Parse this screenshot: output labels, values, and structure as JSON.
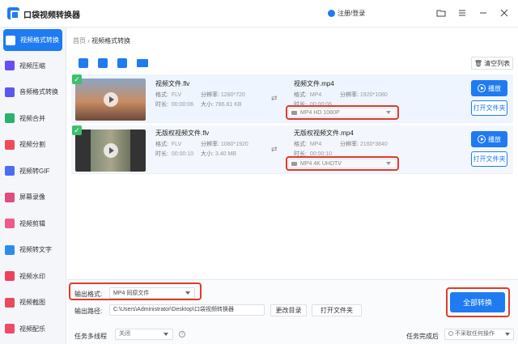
{
  "app": {
    "title": "口袋视频转换器",
    "login": "注册/登录"
  },
  "sidebar": {
    "items": [
      {
        "label": "视频格式转换",
        "icon": "film-convert-icon",
        "color": "#1e7bf2"
      },
      {
        "label": "视频压缩",
        "icon": "compress-icon",
        "color": "#6a4cf5"
      },
      {
        "label": "音频格式转换",
        "icon": "audio-icon",
        "color": "#5b58f0"
      },
      {
        "label": "视频合并",
        "icon": "merge-icon",
        "color": "#27b36a"
      },
      {
        "label": "视频分割",
        "icon": "split-icon",
        "color": "#f04a5a"
      },
      {
        "label": "视频转GIF",
        "icon": "gif-icon",
        "color": "#4c6cf5"
      },
      {
        "label": "屏幕录像",
        "icon": "record-icon",
        "color": "#e14c7c"
      },
      {
        "label": "视频剪辑",
        "icon": "scissors-icon",
        "color": "#f05a8a"
      },
      {
        "label": "视频转文字",
        "icon": "text-icon",
        "color": "#2d8cf0"
      },
      {
        "label": "视频水印",
        "icon": "watermark-icon",
        "color": "#f0405a"
      },
      {
        "label": "视频截图",
        "icon": "screenshot-icon",
        "color": "#e84b5e"
      },
      {
        "label": "视频配乐",
        "icon": "music-icon",
        "color": "#f04a6a"
      }
    ]
  },
  "breadcrumb": {
    "home": "首页",
    "sep": "›",
    "current": "视频格式转换"
  },
  "toolbar": {
    "clear": "清空列表"
  },
  "files": [
    {
      "name": "视频文件.flv",
      "src": {
        "format_label": "格式:",
        "format": "FLV",
        "res_label": "分辨率:",
        "res": "1280*720",
        "dur_label": "时长:",
        "dur": "00:00:06",
        "size_label": "大小:",
        "size": "786.81 KB"
      },
      "out_name": "视频文件.mp4",
      "out": {
        "format_label": "格式:",
        "format": "MP4",
        "res_label": "分辨率:",
        "res": "1920*1080",
        "dur_label": "时长:",
        "dur": "00:00:06"
      },
      "preset": "MP4   HD 1080P",
      "play": "播放",
      "folder": "打开文件夹"
    },
    {
      "name": "无版权视频文件.flv",
      "src": {
        "format_label": "格式:",
        "format": "FLV",
        "res_label": "分辨率:",
        "res": "1080*1920",
        "dur_label": "时长:",
        "dur": "00:00:10",
        "size_label": "大小:",
        "size": "3.40 MB"
      },
      "out_name": "无版权视频文件.mp4",
      "out": {
        "format_label": "格式:",
        "format": "MP4",
        "res_label": "分辨率:",
        "res": "2160*3840",
        "dur_label": "时长:",
        "dur": "00:00:10"
      },
      "preset": "MP4   4K UHDTV",
      "play": "播放",
      "folder": "打开文件夹"
    }
  ],
  "bottom": {
    "out_format_label": "输出格式:",
    "out_format": "MP4   同原文件",
    "out_path_label": "输出路径:",
    "out_path": "C:\\Users\\Administrator\\Desktop\\口袋视频转换器",
    "change_dir": "更改目录",
    "open_folder": "打开文件夹",
    "convert_all": "全部转换",
    "thread_label": "任务多线程",
    "thread_value": "关闭",
    "after_label": "任务完成后",
    "after_value": "不采取任何操作"
  },
  "colors": {
    "accent": "#1e7bf2",
    "highlight": "#e03b2c",
    "check": "#3cc16a"
  }
}
